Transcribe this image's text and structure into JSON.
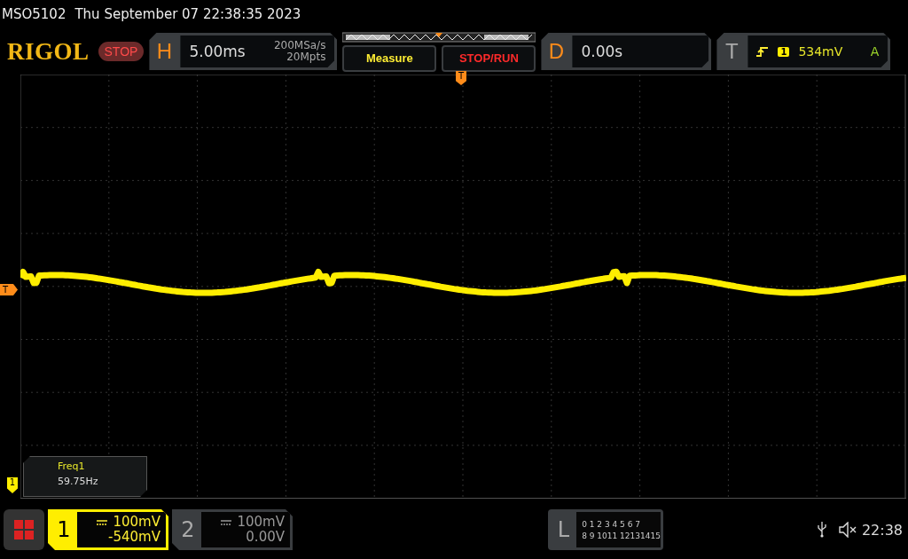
{
  "title_bar": {
    "model": "MSO5102",
    "datetime": "Thu September 07 22:38:35 2023"
  },
  "toolbar": {
    "logo": "RIGOL",
    "run_state": "STOP",
    "horizontal": {
      "label": "H",
      "timebase": "5.00ms",
      "sample_rate": "200MSa/s",
      "memory_depth": "20Mpts"
    },
    "buttons": [
      "Measure",
      "STOP/RUN"
    ],
    "delay": {
      "label": "D",
      "value": "0.00s"
    },
    "trigger": {
      "label": "T",
      "source": "1",
      "level": "534mV",
      "mode": "A"
    }
  },
  "screen": {
    "trigger_position_marker": "T",
    "trigger_level_marker": "T",
    "channel_marker": "1",
    "measurement": {
      "name": "Freq1",
      "value": "59.75Hz"
    }
  },
  "channels": [
    {
      "number": "1",
      "scale": "100mV",
      "offset": "-540mV",
      "selected": true
    },
    {
      "number": "2",
      "scale": "100mV",
      "offset": "0.00V",
      "selected": false
    }
  ],
  "logic": {
    "label": "L",
    "rows": [
      "0 1 2 3  4 5 6 7",
      "8 9 1011 12131415"
    ]
  },
  "status": {
    "time": "22:38"
  }
}
